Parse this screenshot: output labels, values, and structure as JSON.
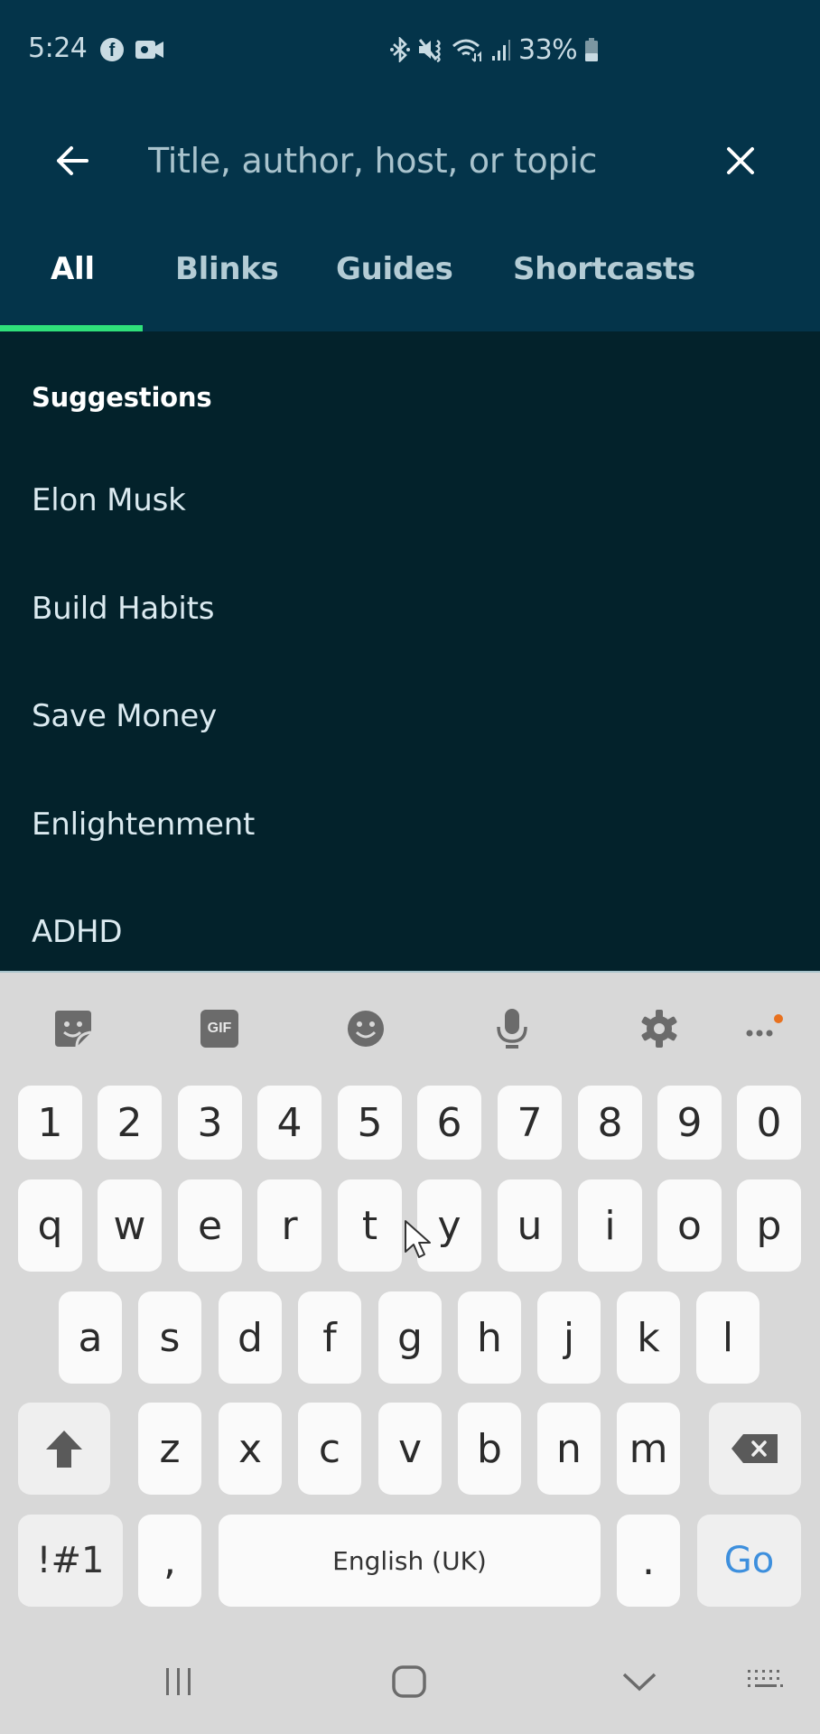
{
  "status_bar": {
    "time": "5:24",
    "battery": "33%",
    "left_icons": [
      "facebook-icon",
      "video-camera-icon"
    ],
    "right_icons": [
      "bluetooth-icon",
      "vibrate-mute-icon",
      "wifi-icon",
      "signal-icon",
      "battery-icon"
    ]
  },
  "search": {
    "placeholder": "Title, author, host, or topic",
    "value": "",
    "back_icon": "arrow-left-icon",
    "clear_icon": "close-icon"
  },
  "tabs": [
    {
      "label": "All",
      "active": true
    },
    {
      "label": "Blinks",
      "active": false
    },
    {
      "label": "Guides",
      "active": false
    },
    {
      "label": "Shortcasts",
      "active": false
    }
  ],
  "suggestions": {
    "title": "Suggestions",
    "items": [
      "Elon Musk",
      "Build Habits",
      "Save Money",
      "Enlightenment",
      "ADHD"
    ]
  },
  "keyboard": {
    "toolbar": [
      "sticker-icon",
      "gif-icon",
      "emoji-icon",
      "microphone-icon",
      "settings-icon",
      "more-icon"
    ],
    "gif_label": "GIF",
    "rows": {
      "numbers": [
        "1",
        "2",
        "3",
        "4",
        "5",
        "6",
        "7",
        "8",
        "9",
        "0"
      ],
      "row1": [
        "q",
        "w",
        "e",
        "r",
        "t",
        "y",
        "u",
        "i",
        "o",
        "p"
      ],
      "row2": [
        "a",
        "s",
        "d",
        "f",
        "g",
        "h",
        "j",
        "k",
        "l"
      ],
      "row3": [
        "z",
        "x",
        "c",
        "v",
        "b",
        "n",
        "m"
      ]
    },
    "symbols_label": "!#1",
    "comma": ",",
    "space_label": "English (UK)",
    "period": ".",
    "go_label": "Go"
  },
  "colors": {
    "header_bg": "#04344a",
    "content_bg": "#03222b",
    "tab_indicator": "#2fe07a",
    "keyboard_bg": "#d8d8d8",
    "go_accent": "#3d8fdd",
    "notification_dot": "#e8711f"
  }
}
